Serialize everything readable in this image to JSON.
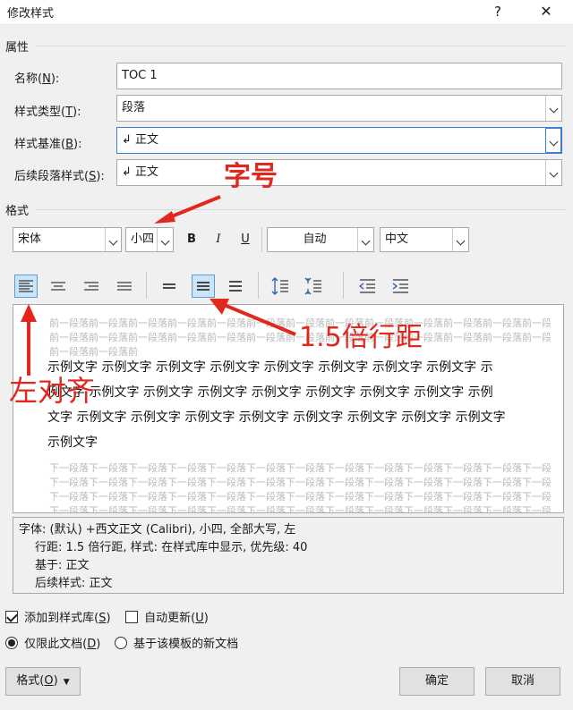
{
  "window": {
    "title": "修改样式",
    "help": "?",
    "close": "✕"
  },
  "properties": {
    "group_label": "属性",
    "name": {
      "label": "名称(N):",
      "value": "TOC 1"
    },
    "style_type": {
      "label": "样式类型(T):",
      "value": "段落"
    },
    "based_on": {
      "label": "样式基准(B):",
      "value": "↲ 正文"
    },
    "next_style": {
      "label": "后续段落样式(S):",
      "value": "↲ 正文"
    }
  },
  "format": {
    "group_label": "格式",
    "font": "宋体",
    "size": "小四",
    "bold": "B",
    "italic": "I",
    "underline": "U",
    "color": "自动",
    "script": "中文"
  },
  "preview": {
    "prev_para": "前一段落前一段落前一段落前一段落前一段落前一段落前一段落前一段落前一段落前一段落前一段落前一段落前一段落前一段落",
    "sample_lines": [
      "示例文字 示例文字 示例文字 示例文字 示例文字 示例文字 示例文字 示例文字 示",
      "例文字 示例文字 示例文字 示例文字 示例文字 示例文字 示例文字 示例文字 示例",
      "文字 示例文字 示例文字 示例文字 示例文字 示例文字 示例文字 示例文字 示例文字",
      "示例文字"
    ],
    "next_para": "下一段落下一段落下一段落下一段落下一段落下一段落下一段落下一段落下一段落下一段落下一段落下一段落下一段落下一段落"
  },
  "description": {
    "line1": "字体: (默认) +西文正文 (Calibri), 小四, 全部大写, 左",
    "line2": "行距: 1.5 倍行距, 样式: 在样式库中显示, 优先级: 40",
    "line3": "基于: 正文",
    "line4": "后续样式: 正文"
  },
  "options": {
    "add_to_gallery": "添加到样式库(S)",
    "auto_update": "自动更新(U)",
    "this_doc_only": "仅限此文档(D)",
    "new_docs": "基于该模板的新文档"
  },
  "buttons": {
    "format": "格式(O)",
    "ok": "确定",
    "cancel": "取消"
  },
  "annotations": {
    "font_size": "字号",
    "line_spacing": "1.5倍行距",
    "left_align": "左对齐"
  },
  "colors": {
    "annotation": "#e0281e",
    "selected": "#cce4f7"
  }
}
